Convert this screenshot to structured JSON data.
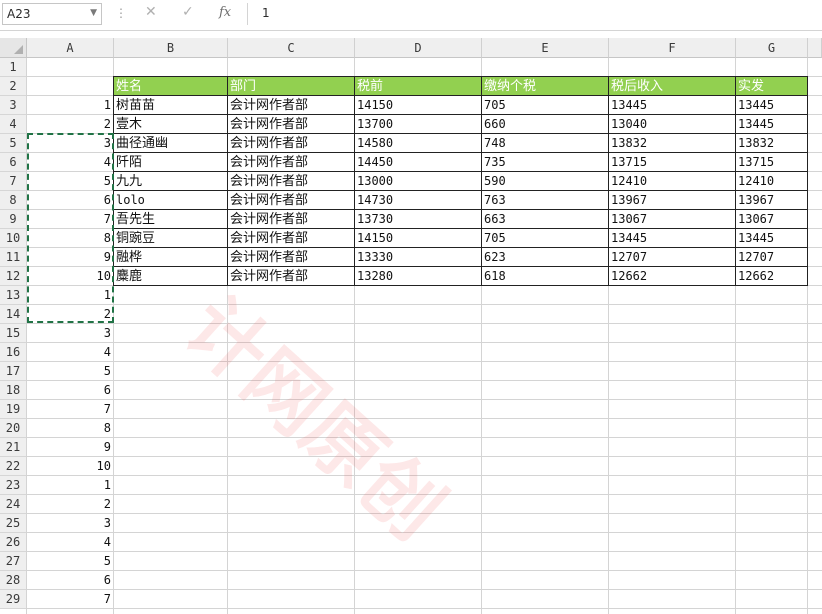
{
  "formula_bar": {
    "name_box": "A23",
    "formula": "1",
    "fx_label": "fx"
  },
  "columns": [
    "A",
    "B",
    "C",
    "D",
    "E",
    "F",
    "G"
  ],
  "rows": [
    "1",
    "2",
    "3",
    "4",
    "5",
    "6",
    "7",
    "8",
    "9",
    "10",
    "11",
    "12",
    "13",
    "14",
    "15",
    "16",
    "17",
    "18",
    "19",
    "20",
    "21",
    "22",
    "23",
    "24",
    "25",
    "26",
    "27",
    "28",
    "29"
  ],
  "column_a_values": [
    "",
    "",
    "1",
    "2",
    "3",
    "4",
    "5",
    "6",
    "7",
    "8",
    "9",
    "10",
    "1",
    "2",
    "3",
    "4",
    "5",
    "6",
    "7",
    "8",
    "9",
    "10",
    "1",
    "2",
    "3",
    "4",
    "5",
    "6",
    "7"
  ],
  "table": {
    "headers": [
      "姓名",
      "部门",
      "税前",
      "缴纳个税",
      "税后收入",
      "实发"
    ],
    "rows": [
      [
        "树苗苗",
        "会计网作者部",
        "14150",
        "705",
        "13445",
        "13445"
      ],
      [
        "壹木",
        "会计网作者部",
        "13700",
        "660",
        "13040",
        "13445"
      ],
      [
        "曲径通幽",
        "会计网作者部",
        "14580",
        "748",
        "13832",
        "13832"
      ],
      [
        "阡陌",
        "会计网作者部",
        "14450",
        "735",
        "13715",
        "13715"
      ],
      [
        "九九",
        "会计网作者部",
        "13000",
        "590",
        "12410",
        "12410"
      ],
      [
        "lolo",
        "会计网作者部",
        "14730",
        "763",
        "13967",
        "13967"
      ],
      [
        "吾先生",
        "会计网作者部",
        "13730",
        "663",
        "13067",
        "13067"
      ],
      [
        "铜豌豆",
        "会计网作者部",
        "14150",
        "705",
        "13445",
        "13445"
      ],
      [
        "融桦",
        "会计网作者部",
        "13330",
        "623",
        "12707",
        "12707"
      ],
      [
        "麋鹿",
        "会计网作者部",
        "13280",
        "618",
        "12662",
        "12662"
      ]
    ]
  },
  "watermark": "计网原创",
  "colors": {
    "header_fill": "#92d050",
    "header_text": "#ffffff",
    "marquee": "#217346"
  }
}
